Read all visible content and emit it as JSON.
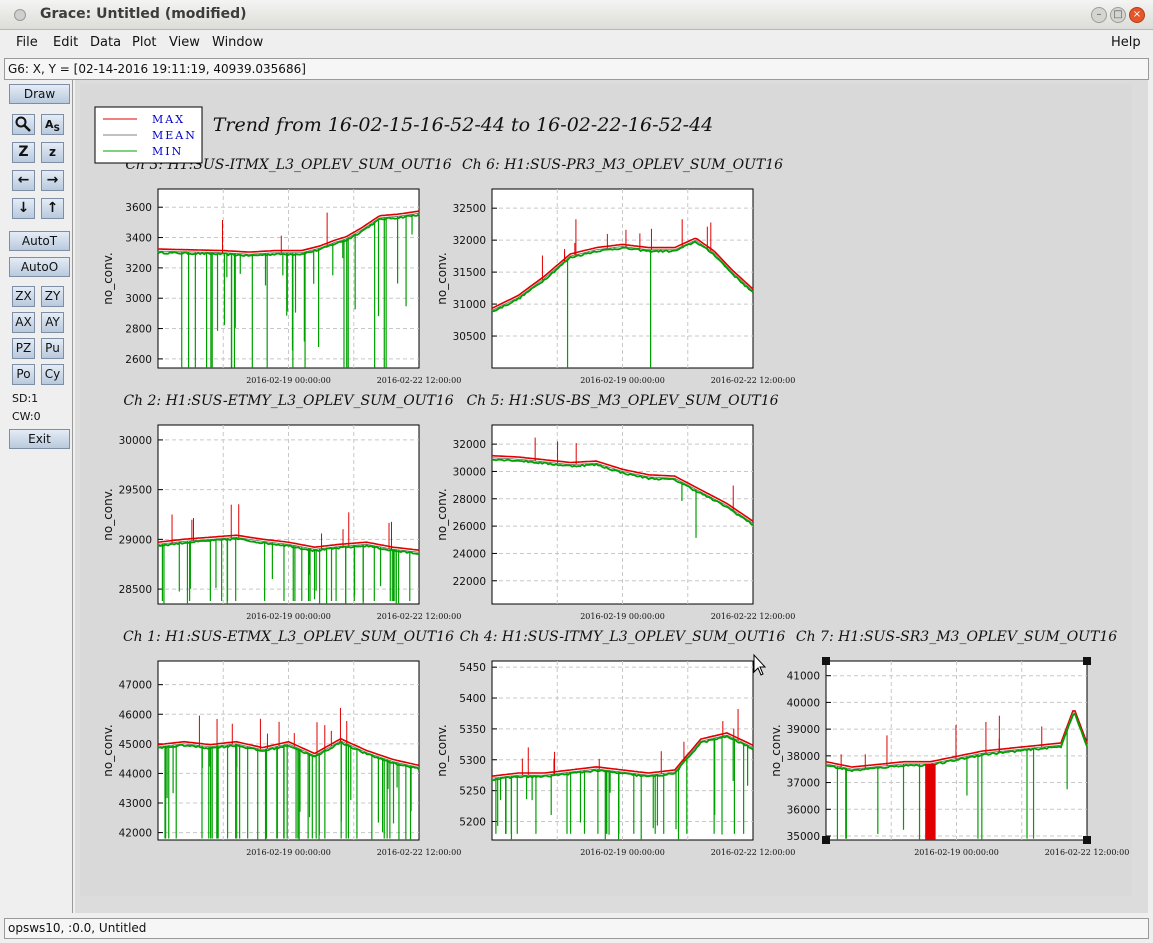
{
  "window": {
    "title": "Grace: Untitled (modified)"
  },
  "menu": {
    "file": "File",
    "edit": "Edit",
    "data": "Data",
    "plot": "Plot",
    "view": "View",
    "window": "Window",
    "help": "Help"
  },
  "coordinates": "G6: X, Y = [02-14-2016 19:11:19, 40939.035686]",
  "toolbar": {
    "draw": "Draw",
    "autot": "AutoT",
    "autoo": "AutoO",
    "zx": "ZX",
    "zy": "ZY",
    "ax": "AX",
    "ay": "AY",
    "pz": "PZ",
    "pu": "Pu",
    "po": "Po",
    "cy": "Cy",
    "sd": "SD:1",
    "cw": "CW:0",
    "exit": "Exit",
    "icons": [
      "zoom-icon",
      "autoscale-text-icon",
      "zoom-x-icon",
      "zoom-y-icon",
      "pan-left-icon",
      "pan-right-icon",
      "pan-down-icon",
      "pan-up-icon"
    ]
  },
  "status": "opsws10, :0.0, Untitled",
  "figure": {
    "title": "Trend from 16-02-15-16-52-44 to 16-02-22-16-52-44",
    "legend": [
      "MAX",
      "MEAN",
      "MIN"
    ],
    "colors": {
      "max": "#e00000",
      "mean": "#808080",
      "min": "#00a000",
      "legend_text": "#0000cc"
    }
  },
  "chart_data": [
    {
      "type": "line",
      "title": "Ch 3: H1:SUS-ITMX_L3_OPLEV_SUM_OUT16",
      "ylabel": "no_conv.",
      "yticks": [
        2600,
        2800,
        3000,
        3200,
        3400,
        3600
      ],
      "ylim": [
        2540,
        3720
      ],
      "xticks": [
        "2016-02-19 00:00:00",
        "2016-02-22 12:00:00"
      ],
      "series": [
        {
          "name": "MEAN",
          "x": [
            0,
            0.25,
            0.35,
            0.45,
            0.55,
            0.62,
            0.68,
            0.72,
            0.78,
            0.85,
            0.92,
            1.0
          ],
          "values": [
            3310,
            3300,
            3290,
            3300,
            3300,
            3330,
            3370,
            3390,
            3450,
            3530,
            3540,
            3560
          ]
        }
      ]
    },
    {
      "type": "line",
      "title": "Ch 6: H1:SUS-PR3_M3_OPLEV_SUM_OUT16",
      "ylabel": "no_conv.",
      "yticks": [
        30500,
        31000,
        31500,
        32000,
        32500
      ],
      "ylim": [
        30000,
        32800
      ],
      "xticks": [
        "2016-02-19 00:00:00",
        "2016-02-22 12:00:00"
      ],
      "series": [
        {
          "name": "MEAN",
          "x": [
            0,
            0.1,
            0.2,
            0.3,
            0.4,
            0.5,
            0.6,
            0.7,
            0.78,
            0.85,
            0.92,
            1.0
          ],
          "values": [
            30900,
            31100,
            31400,
            31750,
            31850,
            31900,
            31850,
            31850,
            32000,
            31800,
            31500,
            31200
          ]
        }
      ]
    },
    {
      "type": "line",
      "title": "Ch 2: H1:SUS-ETMY_L3_OPLEV_SUM_OUT16",
      "ylabel": "no_conv.",
      "yticks": [
        28500,
        29000,
        29500,
        30000
      ],
      "ylim": [
        28350,
        30150
      ],
      "xticks": [
        "2016-02-19 00:00:00",
        "2016-02-22 12:00:00"
      ],
      "series": [
        {
          "name": "MEAN",
          "x": [
            0,
            0.1,
            0.2,
            0.3,
            0.4,
            0.5,
            0.6,
            0.7,
            0.8,
            0.9,
            1.0
          ],
          "values": [
            28950,
            28980,
            29000,
            29020,
            28980,
            28950,
            28900,
            28930,
            28950,
            28900,
            28870
          ]
        }
      ]
    },
    {
      "type": "line",
      "title": "Ch 5: H1:SUS-BS_M3_OPLEV_SUM_OUT16",
      "ylabel": "no_conv.",
      "yticks": [
        22000,
        24000,
        26000,
        28000,
        30000,
        32000
      ],
      "ylim": [
        20300,
        33400
      ],
      "xticks": [
        "2016-02-19 00:00:00",
        "2016-02-22 12:00:00"
      ],
      "series": [
        {
          "name": "MEAN",
          "x": [
            0,
            0.1,
            0.2,
            0.3,
            0.4,
            0.5,
            0.6,
            0.7,
            0.8,
            0.9,
            1.0
          ],
          "values": [
            31000,
            30900,
            30700,
            30500,
            30600,
            30000,
            29600,
            29500,
            28500,
            27500,
            26200
          ]
        }
      ]
    },
    {
      "type": "line",
      "title": "Ch 1: H1:SUS-ETMX_L3_OPLEV_SUM_OUT16",
      "ylabel": "no_conv.",
      "yticks": [
        42000,
        43000,
        44000,
        45000,
        46000,
        47000
      ],
      "ylim": [
        41750,
        47800
      ],
      "xticks": [
        "2016-02-19 00:00:00",
        "2016-02-22 12:00:00"
      ],
      "series": [
        {
          "name": "MEAN",
          "x": [
            0,
            0.1,
            0.2,
            0.3,
            0.4,
            0.5,
            0.6,
            0.7,
            0.8,
            0.9,
            1.0
          ],
          "values": [
            44900,
            45000,
            44900,
            45000,
            44800,
            45000,
            44600,
            45100,
            44700,
            44400,
            44200
          ]
        }
      ]
    },
    {
      "type": "line",
      "title": "Ch 4: H1:SUS-ITMY_L3_OPLEV_SUM_OUT16",
      "ylabel": "no_conv.",
      "yticks": [
        5200,
        5250,
        5300,
        5350,
        5400,
        5450
      ],
      "ylim": [
        5170,
        5460
      ],
      "xticks": [
        "2016-02-19 00:00:00",
        "2016-02-22 12:00:00"
      ],
      "series": [
        {
          "name": "MEAN",
          "x": [
            0,
            0.1,
            0.2,
            0.3,
            0.4,
            0.5,
            0.6,
            0.7,
            0.8,
            0.9,
            1.0
          ],
          "values": [
            5270,
            5275,
            5275,
            5280,
            5285,
            5280,
            5275,
            5280,
            5330,
            5340,
            5320
          ]
        }
      ]
    },
    {
      "type": "line",
      "title": "Ch 7: H1:SUS-SR3_M3_OPLEV_SUM_OUT16",
      "ylabel": "no_conv.",
      "yticks": [
        35000,
        36000,
        37000,
        38000,
        39000,
        40000,
        41000
      ],
      "ylim": [
        34850,
        41550
      ],
      "xticks": [
        "2016-02-19 00:00:00",
        "2016-02-22 12:00:00"
      ],
      "series": [
        {
          "name": "MEAN",
          "x": [
            0,
            0.1,
            0.2,
            0.3,
            0.4,
            0.5,
            0.6,
            0.7,
            0.8,
            0.9,
            0.95,
            1.0
          ],
          "values": [
            37700,
            37500,
            37600,
            37700,
            37700,
            37900,
            38100,
            38200,
            38300,
            38400,
            39700,
            38400
          ]
        }
      ]
    }
  ]
}
